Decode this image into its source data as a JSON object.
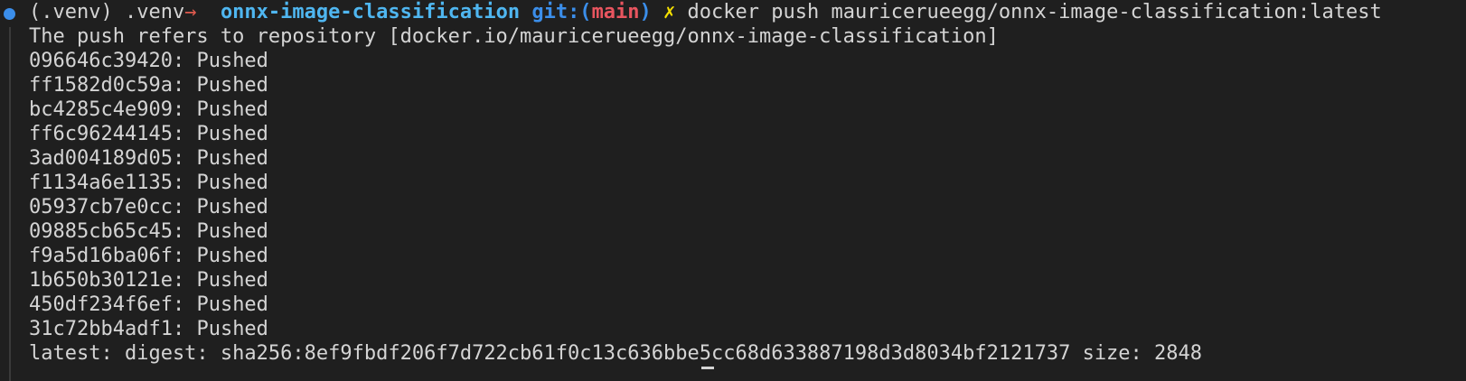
{
  "prompt": {
    "venv": "(.venv) .venv",
    "arrow": "→",
    "directory": "onnx-image-classification",
    "git_label": "git:(",
    "branch": "main",
    "git_close": ")",
    "dirty_marker": "✗",
    "command": "docker push mauricerueegg/onnx-image-classification:latest"
  },
  "output": {
    "header": "The push refers to repository [docker.io/mauricerueegg/onnx-image-classification]",
    "layers": [
      {
        "id": "096646c39420",
        "status": "Pushed"
      },
      {
        "id": "ff1582d0c59a",
        "status": "Pushed"
      },
      {
        "id": "bc4285c4e909",
        "status": "Pushed"
      },
      {
        "id": "ff6c96244145",
        "status": "Pushed"
      },
      {
        "id": "3ad004189d05",
        "status": "Pushed"
      },
      {
        "id": "f1134a6e1135",
        "status": "Pushed"
      },
      {
        "id": "05937cb7e0cc",
        "status": "Pushed"
      },
      {
        "id": "09885cb65c45",
        "status": "Pushed"
      },
      {
        "id": "f9a5d16ba06f",
        "status": "Pushed"
      },
      {
        "id": "1b650b30121e",
        "status": "Pushed"
      },
      {
        "id": "450df234f6ef",
        "status": "Pushed"
      },
      {
        "id": "31c72bb4adf1",
        "status": "Pushed"
      }
    ],
    "digest_line": "latest: digest: sha256:8ef9fbdf206f7d722cb61f0c13c636bbe5cc68d633887198d3d8034bf2121737 size: 2848"
  },
  "colors": {
    "background": "#1f1f1f",
    "prompt_dot": "#3b8eea",
    "text": "#d4d4d4"
  }
}
